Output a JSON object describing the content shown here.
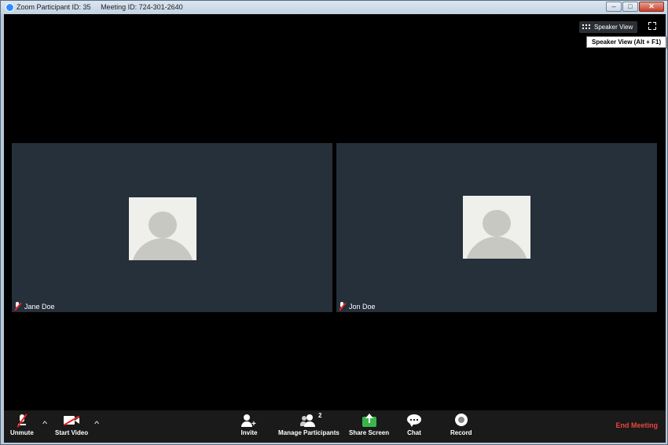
{
  "window": {
    "participant_id": "Zoom Participant ID: 35",
    "meeting_id": "Meeting ID: 724-301-2640",
    "minimize": "–",
    "maximize": "□",
    "close": "✕"
  },
  "view": {
    "speaker_view_label": "Speaker View",
    "tooltip": "Speaker View (Alt + F1)"
  },
  "participants": [
    {
      "name": "Jane Doe",
      "muted": true
    },
    {
      "name": "Jon Doe",
      "muted": true
    }
  ],
  "toolbar": {
    "unmute": "Unmute",
    "start_video": "Start Video",
    "invite": "Invite",
    "manage_participants": "Manage Participants",
    "participant_count": "2",
    "share_screen": "Share Screen",
    "chat": "Chat",
    "record": "Record",
    "end_meeting": "End Meeting",
    "caret": "^"
  },
  "colors": {
    "end_meeting": "#e8463c",
    "share_screen_icon": "#3bb54a",
    "tile_background": "#25303b"
  }
}
